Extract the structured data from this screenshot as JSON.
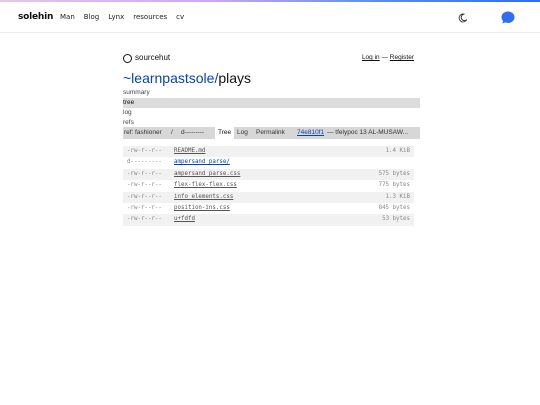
{
  "nav": {
    "logo": "solehin",
    "links": [
      "Man",
      "Blog",
      "Lynx",
      "resources",
      "cv"
    ],
    "icons": {
      "theme": "moon-icon",
      "chat": "chat-bubble-icon"
    },
    "accent": "#2f6df1"
  },
  "header": {
    "site": "sourcehut",
    "login": "Log in",
    "sep": "—",
    "register": "Register",
    "owner": "~learnpastsole",
    "slash": "/",
    "repo": "plays"
  },
  "menu": [
    "summary",
    "tree",
    "log",
    "refs"
  ],
  "refbar": {
    "ref_label": "ref:",
    "ref_value": "fashioner",
    "slash": "/",
    "path": "d---------",
    "tree": "Tree",
    "log": "Log",
    "permalink": "Permalink",
    "commit": "74e810f1",
    "message": "— tfelypoc 13 AL-MUSAW..."
  },
  "files": [
    {
      "perm": "-rw-r--r--",
      "name": "README.md",
      "size": "1.4 KiB"
    },
    {
      "perm": "d---------",
      "name": "ampersand_parse/",
      "size": ""
    },
    {
      "perm": "-rw-r--r--",
      "name": "ampersand_parse.css",
      "size": "575 bytes"
    },
    {
      "perm": "-rw-r--r--",
      "name": "flex-flex-flex.css",
      "size": "775 bytes"
    },
    {
      "perm": "-rw-r--r--",
      "name": "info_elements.css",
      "size": "1.3 KiB"
    },
    {
      "perm": "-rw-r--r--",
      "name": "position-ins.css",
      "size": "845 bytes"
    },
    {
      "perm": "-rw-r--r--",
      "name": "u+fdfd",
      "size": "53 bytes"
    }
  ]
}
